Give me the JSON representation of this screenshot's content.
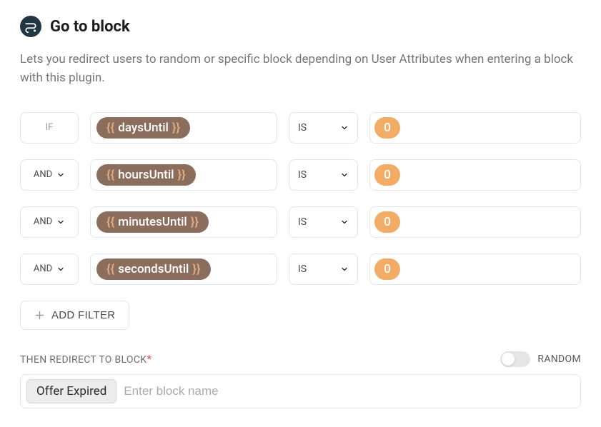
{
  "header": {
    "title": "Go to block"
  },
  "description": "Lets you redirect users to random or specific block depending on User Attributes when entering a block with this plugin.",
  "filters": [
    {
      "connector": "IF",
      "connector_interactable": false,
      "attribute": "daysUntil",
      "operator": "IS",
      "value": "0"
    },
    {
      "connector": "AND",
      "connector_interactable": true,
      "attribute": "hoursUntil",
      "operator": "IS",
      "value": "0"
    },
    {
      "connector": "AND",
      "connector_interactable": true,
      "attribute": "minutesUntil",
      "operator": "IS",
      "value": "0"
    },
    {
      "connector": "AND",
      "connector_interactable": true,
      "attribute": "secondsUntil",
      "operator": "IS",
      "value": "0"
    }
  ],
  "addFilter": {
    "label": "ADD FILTER"
  },
  "redirect": {
    "label": "THEN REDIRECT TO BLOCK",
    "required_mark": "*",
    "random_label": "RANDOM",
    "selected_block": "Offer Expired",
    "placeholder": "Enter block name"
  },
  "braces": {
    "open": "{{",
    "close": "}}"
  }
}
